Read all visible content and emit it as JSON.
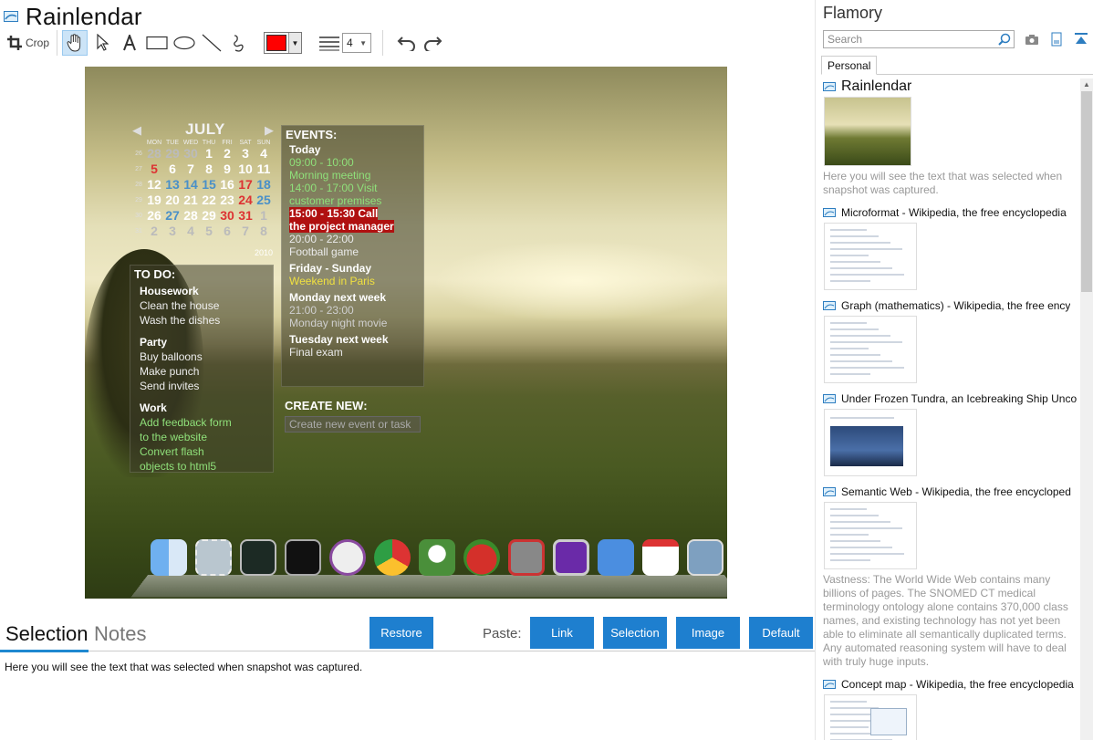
{
  "main": {
    "title": "Rainlendar",
    "toolbar": {
      "crop_label": "Crop",
      "color": "#ff0000",
      "line_width": "4"
    },
    "snapshot": {
      "calendar": {
        "month": "JULY",
        "weekday_headers": [
          "MON",
          "TUE",
          "WED",
          "THU",
          "FRI",
          "SAT",
          "SUN"
        ],
        "weeks": [
          {
            "wk": "26",
            "days": [
              "28",
              "29",
              "30",
              "1",
              "2",
              "3",
              "4"
            ]
          },
          {
            "wk": "27",
            "days": [
              "5",
              "6",
              "7",
              "8",
              "9",
              "10",
              "11"
            ]
          },
          {
            "wk": "28",
            "days": [
              "12",
              "13",
              "14",
              "15",
              "16",
              "17",
              "18"
            ]
          },
          {
            "wk": "29",
            "days": [
              "19",
              "20",
              "21",
              "22",
              "23",
              "24",
              "25"
            ]
          },
          {
            "wk": "30",
            "days": [
              "26",
              "27",
              "28",
              "29",
              "30",
              "31",
              "1"
            ]
          },
          {
            "wk": "31",
            "days": [
              "2",
              "3",
              "4",
              "5",
              "6",
              "7",
              "8"
            ]
          }
        ],
        "year": "2010"
      },
      "events": {
        "header": "EVENTS:",
        "blocks": [
          {
            "title": "Today",
            "lines": [
              {
                "text": "09:00 - 10:00",
                "style": "green"
              },
              {
                "text": "Morning meeting",
                "style": "green"
              },
              {
                "text": "14:00 - 17:00 Visit",
                "style": "green"
              },
              {
                "text": "customer premises",
                "style": "green"
              },
              {
                "text": "15:00 - 15:30 Call",
                "style": "alert"
              },
              {
                "text": "the project manager",
                "style": "alert"
              },
              {
                "text": "20:00 - 22:00",
                "style": "plain"
              },
              {
                "text": "Football game",
                "style": "plain"
              }
            ]
          },
          {
            "title": "Friday - Sunday",
            "lines": [
              {
                "text": "Weekend in Paris",
                "style": "yellow"
              }
            ]
          },
          {
            "title": "Monday next week",
            "lines": [
              {
                "text": "21:00 - 23:00",
                "style": "muted"
              },
              {
                "text": "Monday night movie",
                "style": "muted"
              }
            ]
          },
          {
            "title": "Tuesday next week",
            "lines": [
              {
                "text": "Final exam",
                "style": "plain"
              }
            ]
          }
        ]
      },
      "create_new": {
        "header": "CREATE NEW:",
        "placeholder": "Create new event or task"
      },
      "todo": {
        "header": "TO DO:",
        "groups": [
          {
            "name": "Housework",
            "items": [
              {
                "text": "Clean the house",
                "style": "plain"
              },
              {
                "text": "Wash the dishes",
                "style": "plain"
              }
            ]
          },
          {
            "name": "Party",
            "items": [
              {
                "text": "Buy balloons",
                "style": "plain"
              },
              {
                "text": "Make punch",
                "style": "plain"
              },
              {
                "text": "Send invites",
                "style": "plain"
              }
            ]
          },
          {
            "name": "Work",
            "items": [
              {
                "text": "Add feedback form",
                "style": "green"
              },
              {
                "text": "to the website",
                "style": "green"
              },
              {
                "text": "Convert flash",
                "style": "green"
              },
              {
                "text": "objects to html5",
                "style": "green"
              }
            ]
          }
        ]
      }
    },
    "tabs": {
      "selection": "Selection",
      "notes": "Notes"
    },
    "buttons": {
      "restore": "Restore",
      "paste_label": "Paste:",
      "link": "Link",
      "selection": "Selection",
      "image": "Image",
      "default": "Default"
    },
    "notes_text": "Here you will see the text that was selected when snapshot was captured.",
    "accent_color": "#1e7fcf"
  },
  "sidebar": {
    "title": "Flamory",
    "search_placeholder": "Search",
    "tab": "Personal",
    "items": [
      {
        "title": "Rainlendar",
        "desc": "Here you will see the text that was selected when snapshot was captured."
      },
      {
        "title": "Microformat - Wikipedia, the free encyclopedia",
        "desc": ""
      },
      {
        "title": "Graph (mathematics) - Wikipedia, the free ency",
        "desc": ""
      },
      {
        "title": "Under Frozen Tundra, an Icebreaking Ship Unco",
        "desc": ""
      },
      {
        "title": "Semantic Web - Wikipedia, the free encycloped",
        "desc": "Vastness: The World Wide Web contains many billions of pages. The SNOMED CT medical terminology ontology alone contains 370,000 class names, and existing technology has not yet been able to eliminate all semantically duplicated terms. Any automated reasoning system will have to deal with truly huge inputs."
      },
      {
        "title": "Concept map - Wikipedia, the free encyclopedia",
        "desc": ""
      }
    ]
  }
}
